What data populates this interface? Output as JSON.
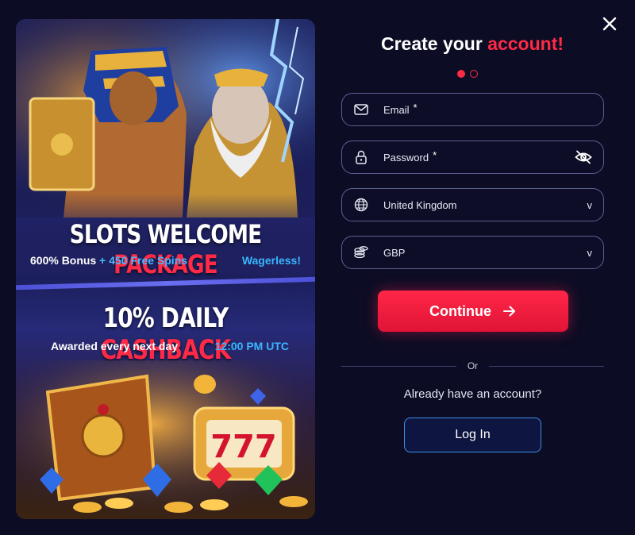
{
  "promo": {
    "welcome_title_main": "SLOTS WELCOME",
    "welcome_title_accent": "PACKAGE",
    "bonus_text": "600% Bonus",
    "spins_text": "+ 450 Free Spins",
    "wagerless_text": "Wagerless!",
    "cashback_title_main": "10% DAILY",
    "cashback_title_accent": "CASHBACK",
    "awarded_text": "Awarded every next day",
    "time_text": "12:00 PM UTC",
    "reel_digits": "777"
  },
  "form": {
    "title_main": "Create your",
    "title_accent": "account!",
    "step_count": 2,
    "active_step": 1,
    "email_label": "Email",
    "email_required_mark": "*",
    "password_label": "Password",
    "password_required_mark": "*",
    "country_value": "United Kingdom",
    "currency_value": "GBP",
    "dropdown_chevron": "v",
    "continue_label": "Continue",
    "or_text": "Or",
    "have_account_text": "Already have an account?",
    "login_label": "Log In"
  },
  "icons": {
    "close": "close-icon",
    "email": "envelope-icon",
    "password": "lock-icon",
    "visibility": "eye-off-icon",
    "country": "globe-icon",
    "currency": "coins-icon",
    "continue_arrow": "arrow-right-icon"
  },
  "colors": {
    "accent_red": "#ff2a46",
    "accent_blue": "#3ab6ff",
    "background": "#0c0c24",
    "field_border": "#5b6190",
    "login_border": "#3c8fe8"
  }
}
